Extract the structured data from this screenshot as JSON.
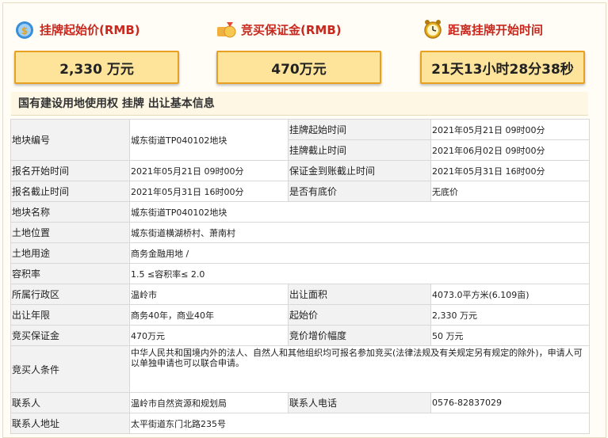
{
  "summary": {
    "start_price": {
      "label": "挂牌起始价(RMB)",
      "value": "2,330 万元",
      "icon": "money-bag-icon"
    },
    "deposit": {
      "label": "竞买保证金(RMB)",
      "value": "470万元",
      "icon": "gold-coins-icon"
    },
    "countdown": {
      "label": "距离挂牌开始时间",
      "value": "21天13小时28分38秒",
      "icon": "alarm-clock-icon"
    }
  },
  "section_title": "国有建设用地使用权 挂牌 出让基本信息",
  "table": {
    "r1": {
      "l1": "地块编号",
      "v1": "城东街道TP040102地块",
      "l2": "挂牌起始时间",
      "v2": "2021年05月21日 09时00分"
    },
    "r2": {
      "l2": "挂牌截止时间",
      "v2": "2021年06月02日 09时00分"
    },
    "r3": {
      "l1": "报名开始时间",
      "v1": "2021年05月21日 09时00分",
      "l2": "保证金到账截止时间",
      "v2": "2021年05月31日 16时00分"
    },
    "r4": {
      "l1": "报名截止时间",
      "v1": "2021年05月31日 16时00分",
      "l2": "是否有底价",
      "v2": "无底价"
    },
    "r5": {
      "l1": "地块名称",
      "v1": "城东街道TP040102地块"
    },
    "r6": {
      "l1": "土地位置",
      "v1": "城东街道横湖桥村、萧南村"
    },
    "r7": {
      "l1": "土地用途",
      "v1": "商务金融用地 /"
    },
    "r8": {
      "l1": "容积率",
      "v1": "1.5 ≤容积率≤ 2.0"
    },
    "r9": {
      "l1": "所属行政区",
      "v1": "温岭市",
      "l2": "出让面积",
      "v2": "4073.0平方米(6.109亩)"
    },
    "r10": {
      "l1": "出让年限",
      "v1": "商务40年，商业40年",
      "l2": "起始价",
      "v2": "2,330 万元"
    },
    "r11": {
      "l1": "竞买保证金",
      "v1": "470万元",
      "l2": "竞价增价幅度",
      "v2": "50 万元"
    },
    "r12": {
      "l1": "竞买人条件",
      "v1": "中华人民共和国境内外的法人、自然人和其他组织均可报名参加竞买(法律法规及有关规定另有规定的除外)，申请人可以单独申请也可以联合申请。"
    },
    "r13": {
      "l1": "联系人",
      "v1": "温岭市自然资源和规划局",
      "l2": "联系人电话",
      "v2": "0576-82837029"
    },
    "r14": {
      "l1": "联系人地址",
      "v1": "太平街道东门北路235号"
    }
  },
  "colors": {
    "accent_red": "#c8281e",
    "box_fill": "#fde49a",
    "box_border": "#e8a020"
  }
}
